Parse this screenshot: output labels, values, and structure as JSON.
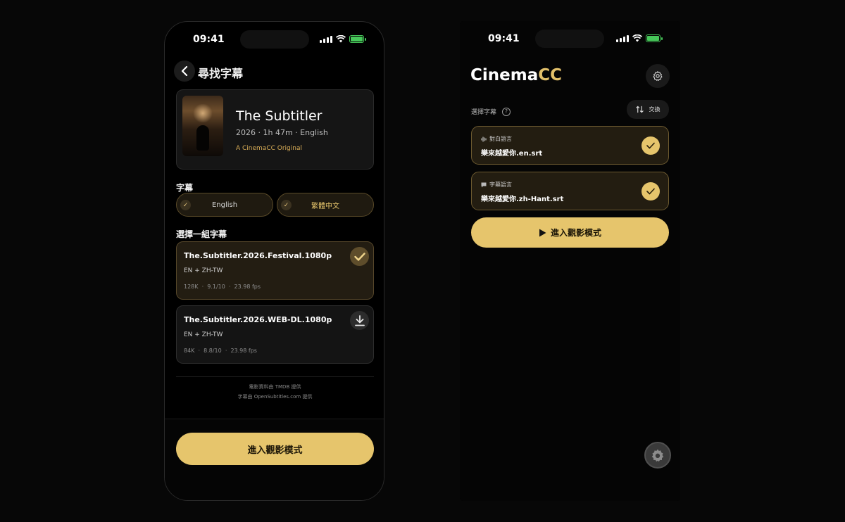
{
  "left_screen": {
    "status_time": "09:41",
    "nav": {
      "title": "尋找字幕"
    },
    "movie": {
      "title": "The Subtitler",
      "meta": "2026 · 1h 47m · English",
      "original_tag": "A CinemaCC Original"
    },
    "subtitles_label": "字幕",
    "languages": [
      {
        "label": "English",
        "selected": true
      },
      {
        "label": "繁體中文",
        "selected": true
      }
    ],
    "choose_label": "選擇一組字幕",
    "subtitle_sets": [
      {
        "name": "The.Subtitler.2026.Festival.1080p",
        "langs": "EN + ZH-TW",
        "stats": "128K  ·  9.1/10  ·  23.98 fps",
        "state": "selected"
      },
      {
        "name": "The.Subtitler.2026.WEB-DL.1080p",
        "langs": "EN + ZH-TW",
        "stats": "84K  ·  8.8/10  ·  23.98 fps",
        "state": "download"
      }
    ],
    "credits": [
      "電影資料由 TMDB 提供",
      "字幕由 OpenSubtitles.com 提供"
    ],
    "cta_label": "進入觀影模式"
  },
  "right_screen": {
    "status_time": "09:41",
    "app_title_main": "Cinema",
    "app_title_accent": "CC",
    "select_label": "選擇字幕",
    "swap_label": "交換",
    "files": [
      {
        "label": "對白語言",
        "name": "樂來越愛你.en.srt"
      },
      {
        "label": "字幕語言",
        "name": "樂來越愛你.zh-Hant.srt"
      }
    ],
    "watch_label": "進入觀影模式"
  },
  "colors": {
    "accent": "#e6c56c",
    "background": "#000000",
    "card_selected": "#231d12",
    "battery": "#47c85a"
  }
}
